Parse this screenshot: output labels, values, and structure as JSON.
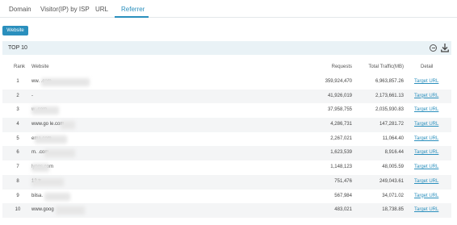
{
  "tabs": [
    {
      "label": "Domain"
    },
    {
      "label": "Visitor(IP) by ISP"
    },
    {
      "label": "URL"
    },
    {
      "label": "Referrer",
      "active": true
    }
  ],
  "filter": {
    "website_label": "Website"
  },
  "panel": {
    "title": "TOP 10"
  },
  "table": {
    "headers": {
      "rank": "Rank",
      "website": "Website",
      "requests": "Requests",
      "traffic": "Total Traffic(MB)",
      "detail": "Detail"
    },
    "rows": [
      {
        "rank": "1",
        "website": "ww.        .com",
        "requests": "359,924,470",
        "traffic": "6,963,857.26",
        "detail": "Target URL"
      },
      {
        "rank": "2",
        "website": "-",
        "requests": "41,926,019",
        "traffic": "2,173,661.13",
        "detail": "Target URL"
      },
      {
        "rank": "3",
        "website": "w          .com",
        "requests": "37,958,755",
        "traffic": "2,035,930.83",
        "detail": "Target URL"
      },
      {
        "rank": "4",
        "website": "www.go   le.com",
        "requests": "4,286,731",
        "traffic": "147,281.72",
        "detail": "Target URL"
      },
      {
        "rank": "5",
        "website": "ema.com",
        "requests": "2,267,021",
        "traffic": "11,064.40",
        "detail": "Target URL"
      },
      {
        "rank": "6",
        "website": "m.        .com",
        "requests": "1,623,539",
        "traffic": "8,916.44",
        "detail": "Target URL"
      },
      {
        "rank": "7",
        "website": "lypgs.com",
        "requests": "1,148,123",
        "traffic": "48,005.59",
        "detail": "Target URL"
      },
      {
        "rank": "8",
        "website": "12.tr",
        "requests": "751,476",
        "traffic": "249,043.61",
        "detail": "Target URL"
      },
      {
        "rank": "9",
        "website": "bilsa.",
        "requests": "567,984",
        "traffic": "34,071.02",
        "detail": "Target URL"
      },
      {
        "rank": "10",
        "website": "www.goog",
        "requests": "483,021",
        "traffic": "18,738.85",
        "detail": "Target URL"
      }
    ]
  },
  "colors": {
    "accent": "#2a8fbd",
    "panel_header": "#e9f2f6",
    "row_alt": "#f4f5f6"
  },
  "icons": [
    "collapse-icon",
    "download-icon"
  ]
}
